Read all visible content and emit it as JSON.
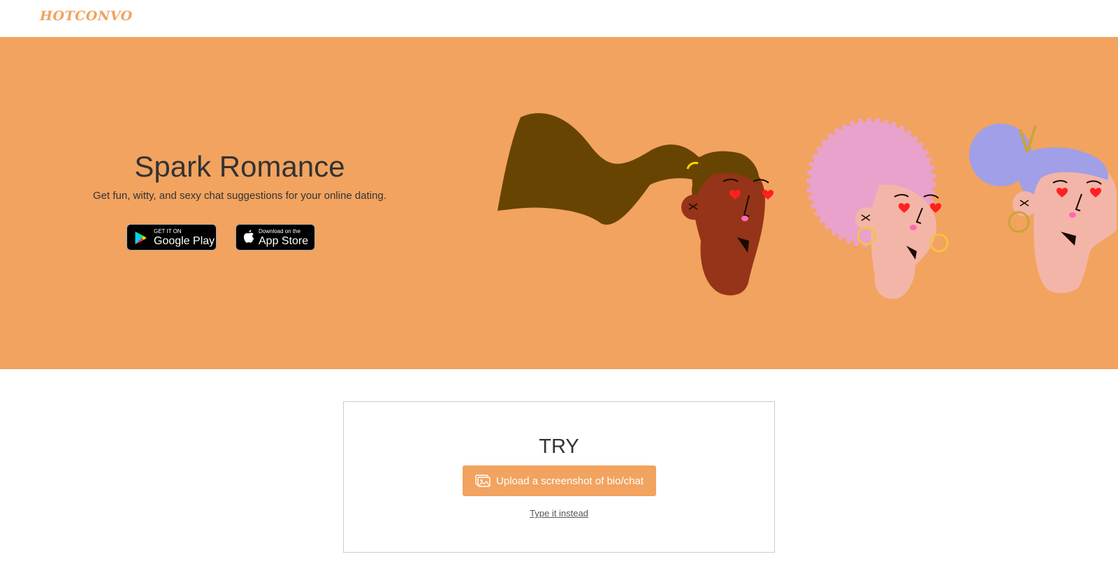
{
  "brand": {
    "logo_text": "HOTCONVO",
    "accent_color": "#f2a35f"
  },
  "hero": {
    "title": "Spark Romance",
    "subtitle": "Get fun, witty, and sexy chat suggestions for your online dating.",
    "background_color": "#f2a35f",
    "google_badge": {
      "small_text": "GET IT ON",
      "big_text": "Google Play",
      "icon": "google-play-icon"
    },
    "apple_badge": {
      "small_text": "Download on the",
      "big_text": "App Store",
      "icon": "apple-icon"
    },
    "illustration": {
      "description_icon": "three-women-heart-eyes-illustration"
    }
  },
  "try_section": {
    "title": "TRY",
    "upload_label": "Upload a screenshot of bio/chat",
    "upload_icon": "image-upload-icon",
    "type_link": "Type it instead"
  }
}
